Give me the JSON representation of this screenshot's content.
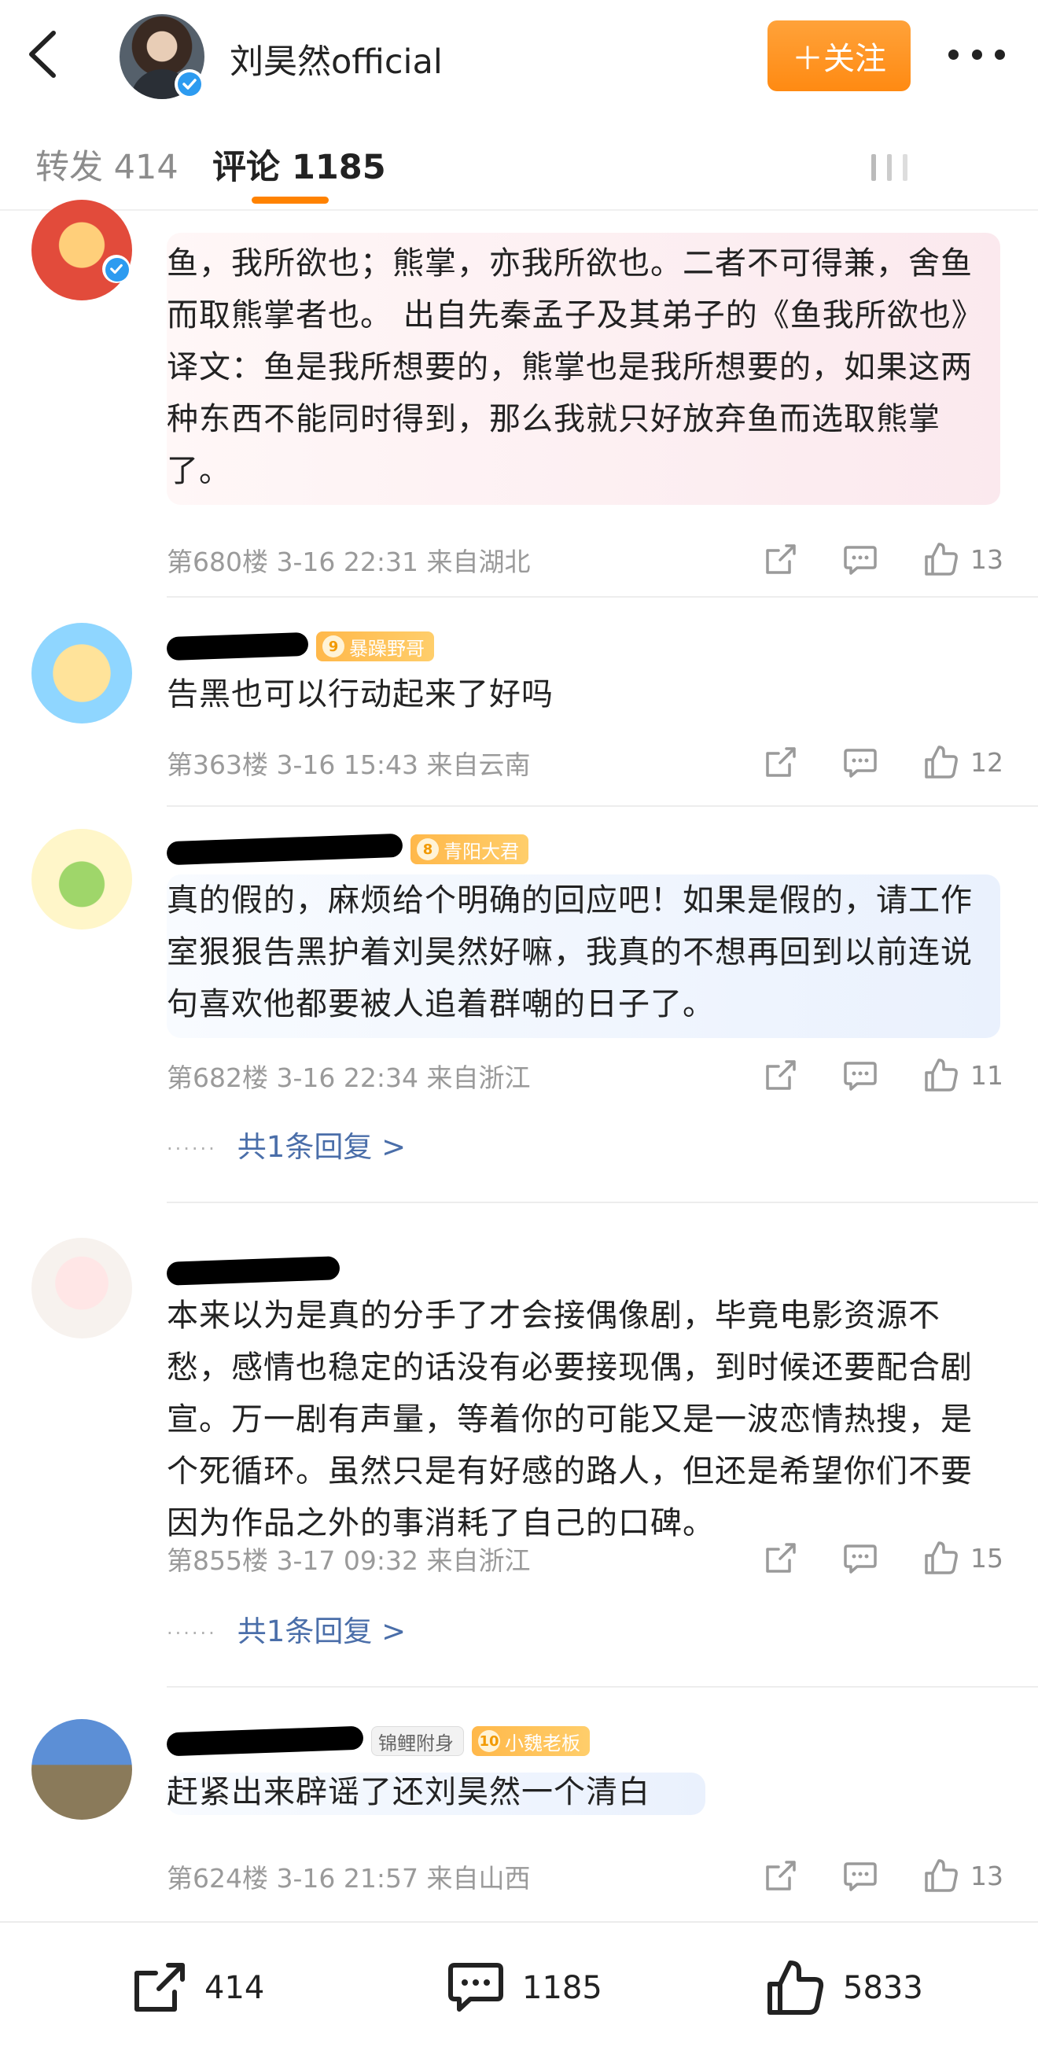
{
  "header": {
    "account_name": "刘昊然official",
    "follow_label": "＋关注",
    "icons": {
      "back": "chevron-left-icon",
      "more": "more-dots-icon",
      "verified": "verified-badge-icon"
    }
  },
  "tabs": {
    "repost_label": "转发 414",
    "comment_label": "评论 1185"
  },
  "comments": [
    {
      "badge": "",
      "text": "鱼，我所欲也；熊掌，亦我所欲也。二者不可得兼，舍鱼而取熊掌者也。 出自先秦孟子及其弟子的《鱼我所欲也》译文：鱼是我所想要的，熊掌也是我所想要的，如果这两种东西不能同时得到，那么我就只好放弃鱼而选取熊掌了。",
      "meta": "第680楼 3-16 22:31 来自湖北",
      "likes": "13"
    },
    {
      "badge_level": "9",
      "badge": "暴躁野哥",
      "text": "告黑也可以行动起来了好吗",
      "meta": "第363楼 3-16 15:43 来自云南",
      "likes": "12"
    },
    {
      "badge_level": "8",
      "badge": "青阳大君",
      "text": "真的假的，麻烦给个明确的回应吧！如果是假的，请工作室狠狠告黑护着刘昊然好嘛，我真的不想再回到以前连说句喜欢他都要被人追着群嘲的日子了。",
      "meta": "第682楼 3-16 22:34 来自浙江",
      "likes": "11",
      "replies": "共1条回复 >"
    },
    {
      "text": "本来以为是真的分手了才会接偶像剧，毕竟电影资源不愁，感情也稳定的话没有必要接现偶，到时候还要配合剧宣。万一剧有声量，等着你的可能又是一波恋情热搜，是个死循环。虽然只是有好感的路人，但还是希望你们不要因为作品之外的事消耗了自己的口碑。",
      "meta": "第855楼 3-17 09:32 来自浙江",
      "likes": "15",
      "replies": "共1条回复 >"
    },
    {
      "tag": "锦鲤附身",
      "badge_level": "10",
      "badge": "小魏老板",
      "text": "赶紧出来辟谣了还刘昊然一个清白",
      "meta": "第624楼 3-16 21:57 来自山西",
      "likes": "13"
    }
  ],
  "bottom_bar": {
    "repost_count": "414",
    "comment_count": "1185",
    "like_count": "5833"
  }
}
